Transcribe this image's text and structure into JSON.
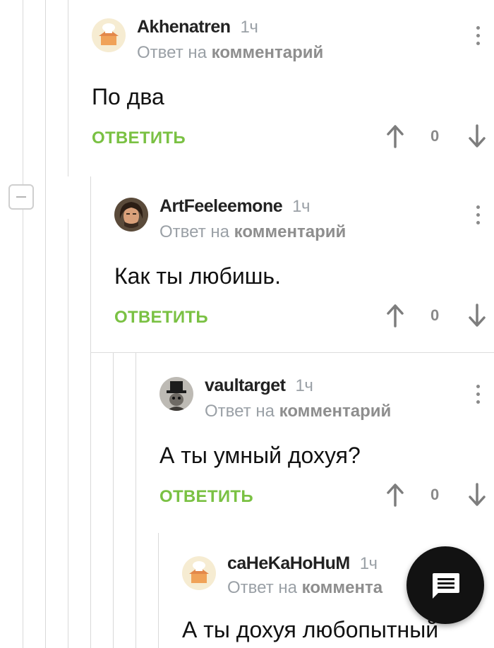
{
  "thread": {
    "comments": [
      {
        "author": "Akhenatren",
        "time": "1ч",
        "reply_prefix": "Ответ на",
        "reply_target": "комментарий",
        "text": "По два",
        "reply_label": "ОТВЕТИТЬ",
        "votes": "0",
        "avatar": "house-chef-avatar"
      },
      {
        "author": "ArtFeeleemone",
        "time": "1ч",
        "reply_prefix": "Ответ на",
        "reply_target": "комментарий",
        "text": "Как ты любишь.",
        "reply_label": "ОТВЕТИТЬ",
        "votes": "0",
        "avatar": "man-portrait-avatar"
      },
      {
        "author": "vaultarget",
        "time": "1ч",
        "reply_prefix": "Ответ на",
        "reply_target": "комментарий",
        "text": "А ты умный дохуя?",
        "reply_label": "ОТВЕТИТЬ",
        "votes": "0",
        "avatar": "top-hat-avatar"
      },
      {
        "author": "caHeKaHoHuM",
        "time": "1ч",
        "reply_prefix": "Ответ на",
        "reply_target": "коммента",
        "text": "А ты дохуя любопытный",
        "avatar": "house-chef-avatar"
      }
    ]
  },
  "fab": {
    "icon": "comment-icon"
  },
  "colors": {
    "accent_green": "#7ac143",
    "muted_gray": "#9aa0a6",
    "fab_bg": "#121212"
  }
}
